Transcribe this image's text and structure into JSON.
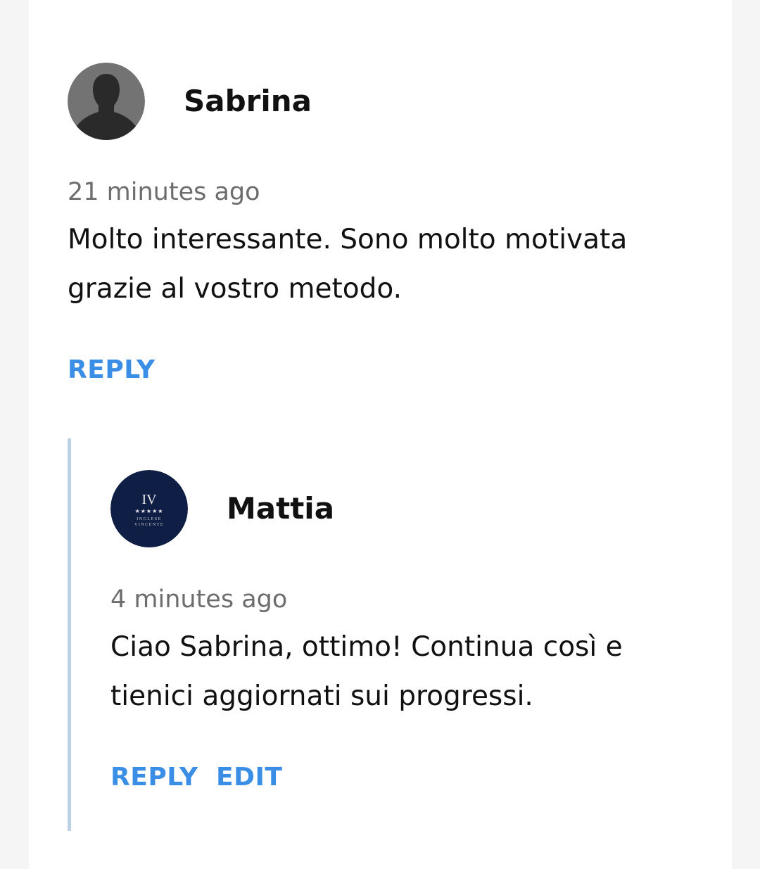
{
  "comments": [
    {
      "author": "Sabrina",
      "avatar": "default-user-avatar",
      "time": "21 minutes ago",
      "text": "Molto interessante. Sono molto motivata grazie al vostro metodo.",
      "actions": {
        "reply": "REPLY"
      }
    }
  ],
  "reply": {
    "author": "Mattia",
    "avatar": {
      "icon": "inglese-vincente-logo",
      "monogram": "IV",
      "stars": "★★★★★",
      "line1": "INGLESE",
      "line2": "VINCENTE",
      "color": "#0f1e45"
    },
    "time": "4 minutes ago",
    "text": "Ciao Sabrina, ottimo! Continua così e tienici aggiornati sui progressi.",
    "actions": {
      "reply": "REPLY",
      "edit": "EDIT"
    }
  },
  "colors": {
    "accent": "#3a8ee6",
    "thread_line": "#bcd0e4"
  }
}
